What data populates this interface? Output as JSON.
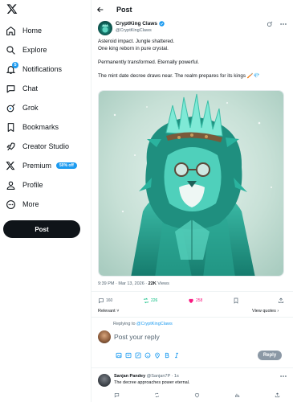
{
  "sidebar": {
    "logo": "x-logo-icon",
    "items": [
      {
        "label": "Home",
        "icon": "home-icon"
      },
      {
        "label": "Explore",
        "icon": "search-icon"
      },
      {
        "label": "Notifications",
        "icon": "bell-icon",
        "badge": "5"
      },
      {
        "label": "Chat",
        "icon": "chat-icon"
      },
      {
        "label": "Grok",
        "icon": "grok-icon"
      },
      {
        "label": "Bookmarks",
        "icon": "bookmark-icon"
      },
      {
        "label": "Creator Studio",
        "icon": "rocket-icon"
      },
      {
        "label": "Premium",
        "icon": "x-premium-icon",
        "pill": "50% off"
      },
      {
        "label": "Profile",
        "icon": "person-icon"
      },
      {
        "label": "More",
        "icon": "more-circle-icon"
      }
    ],
    "post_button": "Post"
  },
  "header": {
    "title": "Post"
  },
  "post": {
    "author_name": "CryptKing Claws",
    "author_handle": "@CryptKingClaws",
    "text_lines": [
      "Asteroid impact. Jungle shattered.",
      "One king reborn in pure crystal.",
      "Permanently transformed. Eternally powerful.",
      "The mint date decree draws near. The realm prepares for its kings 🪥💎"
    ],
    "meta_time": "9:39 PM · Mar 13, 2026 · ",
    "meta_views_count": "22K",
    "meta_views_label": " Views",
    "replies": "160",
    "reposts": "226",
    "likes": "258",
    "sort_label": "Relevant ˅",
    "view_quotes": "View quotes ›"
  },
  "composer": {
    "replying_prefix": "Replying to ",
    "replying_handle": "@CryptKingClaws",
    "placeholder": "Post your reply",
    "reply_button": "Reply"
  },
  "reply": {
    "name": "Sanjan Pandey",
    "handle_time": "@Sanjan7P · 1s",
    "text": "The decree approaches power eternal."
  },
  "colors": {
    "accent": "#1d9bf0",
    "like": "#f91880",
    "repost": "#00ba7c",
    "text": "#0f1419",
    "muted": "#536471"
  }
}
